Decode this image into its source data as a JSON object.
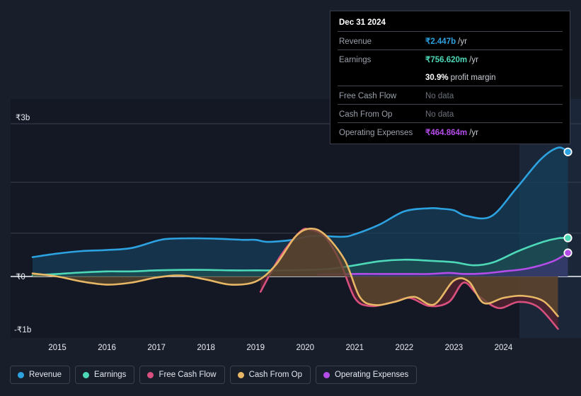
{
  "chart_data": {
    "type": "area",
    "title": "",
    "xlabel": "",
    "ylabel": "",
    "currency_symbol": "₹",
    "grid": true,
    "legend_position": "bottom-left",
    "xlim": [
      2014.5,
      2025.35
    ],
    "ylim": [
      -1.25,
      3.0
    ],
    "yticks": [
      3,
      0,
      -1
    ],
    "ytick_labels": [
      "₹3b",
      "₹0",
      "-₹1b"
    ],
    "gridlines": [
      3.0,
      1.85,
      0.85,
      0.0
    ],
    "xticks": [
      2015,
      2016,
      2017,
      2018,
      2019,
      2020,
      2021,
      2022,
      2023,
      2024
    ],
    "xtick_labels": [
      "2015",
      "2016",
      "2017",
      "2018",
      "2019",
      "2020",
      "2021",
      "2022",
      "2023",
      "2024"
    ],
    "forecast_band_start": 2025.3,
    "units": "billions of INR",
    "series": [
      {
        "name": "Revenue",
        "color": "#2da2e0",
        "fill": "#16405c",
        "marker_end": true,
        "x": [
          2014.5,
          2015.0,
          2015.5,
          2016.0,
          2016.5,
          2017.0,
          2017.25,
          2017.75,
          2018.25,
          2018.75,
          2019.0,
          2019.25,
          2019.75,
          2020.0,
          2020.25,
          2020.75,
          2021.0,
          2021.5,
          2022.0,
          2022.5,
          2022.75,
          2023.0,
          2023.25,
          2023.75,
          2024.25,
          2024.75,
          2025.1,
          2025.3
        ],
        "values": [
          0.38,
          0.45,
          0.5,
          0.52,
          0.56,
          0.7,
          0.74,
          0.75,
          0.74,
          0.72,
          0.72,
          0.68,
          0.72,
          0.78,
          0.8,
          0.78,
          0.83,
          1.02,
          1.28,
          1.34,
          1.33,
          1.3,
          1.19,
          1.18,
          1.72,
          2.3,
          2.53,
          2.447
        ]
      },
      {
        "name": "Earnings",
        "color": "#4dd9b8",
        "fill": "#1d4f52",
        "marker_end": true,
        "x": [
          2014.5,
          2015.0,
          2015.5,
          2016.0,
          2016.5,
          2017.0,
          2017.5,
          2018.0,
          2018.5,
          2019.0,
          2019.5,
          2020.0,
          2020.5,
          2021.0,
          2021.5,
          2022.0,
          2022.5,
          2023.0,
          2023.4,
          2023.8,
          2024.3,
          2024.8,
          2025.1,
          2025.3
        ],
        "values": [
          0.02,
          0.05,
          0.08,
          0.1,
          0.1,
          0.12,
          0.13,
          0.13,
          0.12,
          0.12,
          0.12,
          0.13,
          0.15,
          0.22,
          0.3,
          0.33,
          0.31,
          0.28,
          0.22,
          0.28,
          0.5,
          0.68,
          0.75,
          0.75662
        ]
      },
      {
        "name": "Free Cash Flow",
        "color": "#d94f7e",
        "fill": "#5a2430",
        "marker_end": false,
        "x": [
          2019.1,
          2019.5,
          2019.9,
          2020.1,
          2020.4,
          2020.7,
          2021.0,
          2021.3,
          2021.7,
          2022.1,
          2022.5,
          2022.9,
          2023.2,
          2023.5,
          2023.9,
          2024.3,
          2024.7,
          2025.1
        ],
        "values": [
          -0.3,
          0.4,
          0.88,
          0.92,
          0.78,
          0.3,
          -0.42,
          -0.58,
          -0.52,
          -0.42,
          -0.58,
          -0.5,
          -0.12,
          -0.38,
          -0.62,
          -0.5,
          -0.6,
          -1.03
        ]
      },
      {
        "name": "Cash From Op",
        "color": "#e8b765",
        "fill": "#5a4a2c",
        "marker_end": false,
        "x": [
          2014.5,
          2015.0,
          2015.5,
          2016.0,
          2016.5,
          2017.0,
          2017.5,
          2018.0,
          2018.5,
          2019.0,
          2019.4,
          2019.8,
          2020.1,
          2020.4,
          2020.8,
          2021.1,
          2021.4,
          2021.8,
          2022.2,
          2022.6,
          2023.0,
          2023.3,
          2023.6,
          2024.0,
          2024.4,
          2024.8,
          2025.1
        ],
        "values": [
          0.06,
          0.0,
          -0.1,
          -0.16,
          -0.12,
          -0.02,
          0.02,
          -0.06,
          -0.16,
          -0.1,
          0.22,
          0.78,
          0.94,
          0.82,
          0.32,
          -0.4,
          -0.56,
          -0.5,
          -0.4,
          -0.55,
          -0.08,
          -0.1,
          -0.52,
          -0.42,
          -0.38,
          -0.48,
          -0.78
        ]
      },
      {
        "name": "Operating Expenses",
        "color": "#b44de8",
        "fill": "#3c3470",
        "marker_end": true,
        "x": [
          2020.25,
          2020.6,
          2021.0,
          2021.5,
          2022.0,
          2022.5,
          2022.9,
          2023.2,
          2023.6,
          2024.0,
          2024.5,
          2025.0,
          2025.3
        ],
        "values": [
          0.035,
          0.04,
          0.05,
          0.05,
          0.05,
          0.05,
          0.07,
          0.05,
          0.06,
          0.1,
          0.16,
          0.3,
          0.464864
        ]
      }
    ]
  },
  "tooltip": {
    "date": "Dec 31 2024",
    "rows": [
      {
        "label": "Revenue",
        "value": "₹2.447b",
        "suffix": "/yr",
        "color": "#2da2e0",
        "no_data": false
      },
      {
        "label": "Earnings",
        "value": "₹756.620m",
        "suffix": "/yr",
        "color": "#4dd9b8",
        "no_data": false
      },
      {
        "label": "",
        "value": "30.9%",
        "suffix": "profit margin",
        "color": "#ffffff",
        "no_data": false
      },
      {
        "label": "Free Cash Flow",
        "value": "No data",
        "suffix": "",
        "color": "#6d727c",
        "no_data": true
      },
      {
        "label": "Cash From Op",
        "value": "No data",
        "suffix": "",
        "color": "#6d727c",
        "no_data": true
      },
      {
        "label": "Operating Expenses",
        "value": "₹464.864m",
        "suffix": "/yr",
        "color": "#b44de8",
        "no_data": false
      }
    ]
  },
  "legend": {
    "items": [
      {
        "label": "Revenue",
        "color": "#2da2e0"
      },
      {
        "label": "Earnings",
        "color": "#4dd9b8"
      },
      {
        "label": "Free Cash Flow",
        "color": "#d94f7e"
      },
      {
        "label": "Cash From Op",
        "color": "#e8b765"
      },
      {
        "label": "Operating Expenses",
        "color": "#b44de8"
      }
    ]
  }
}
